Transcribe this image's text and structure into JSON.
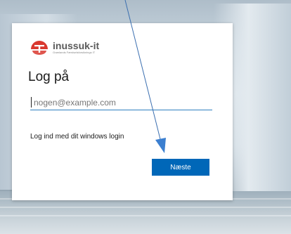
{
  "brand": {
    "name": "inussuk-it",
    "tagline": "Grønlands Færdselsforsiknings IT",
    "accent_color": "#d9382f"
  },
  "login": {
    "title": "Log på",
    "email_placeholder": "nogen@example.com",
    "windows_login_link": "Log ind med dit windows login",
    "next_button": "Næste",
    "button_color": "#0067b8"
  }
}
